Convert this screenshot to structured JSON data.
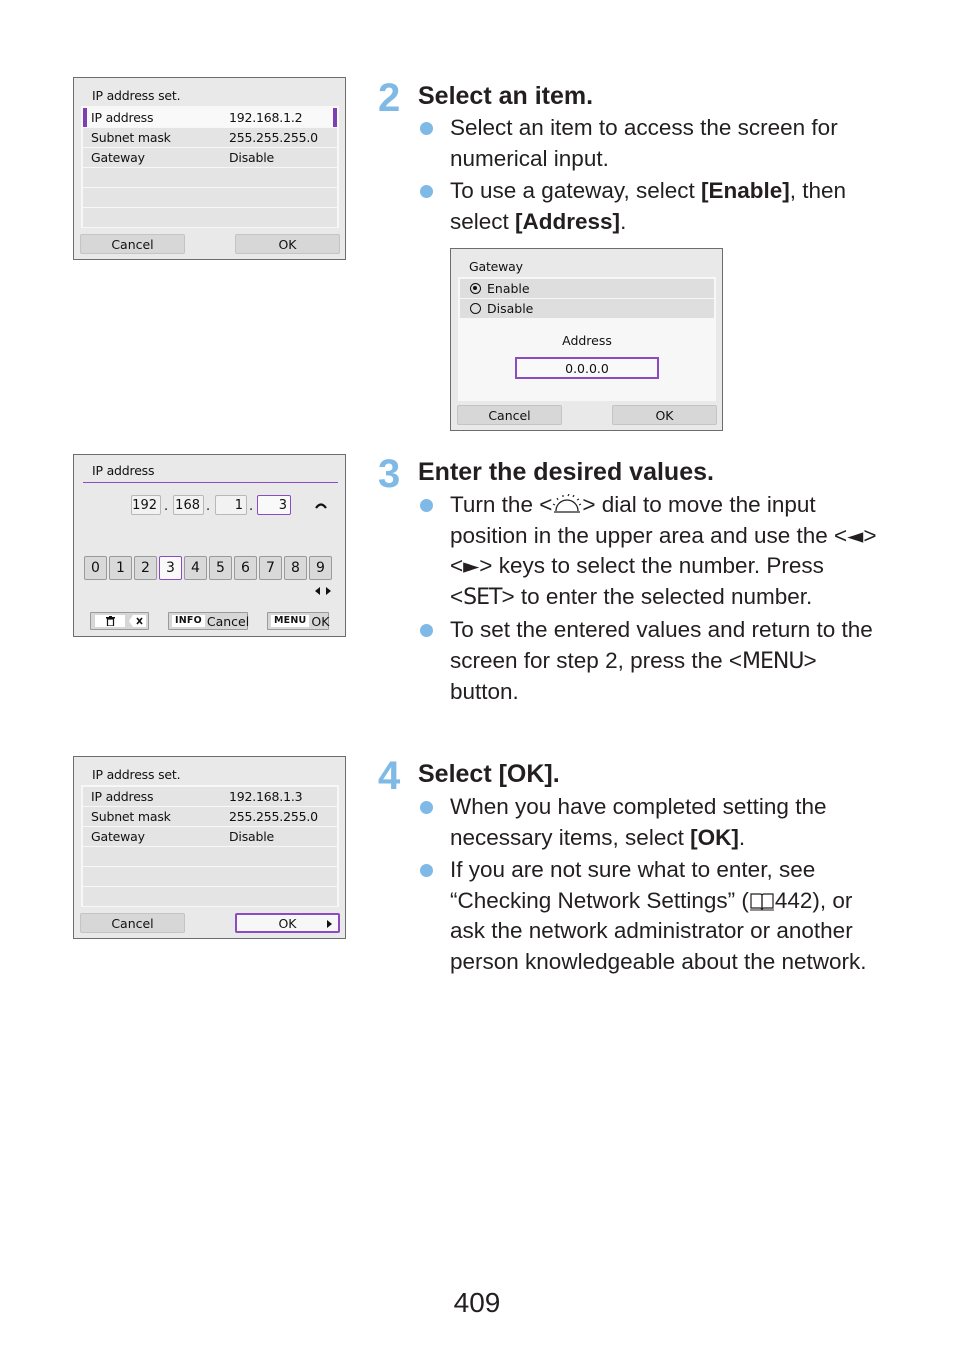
{
  "page_number": "409",
  "colors": {
    "step_number": "#7fb9e6",
    "bullet": "#7fb9e6",
    "focus_highlight": "#8a4cc0",
    "screen_bg": "#e9e9e9"
  },
  "screen1": {
    "title": "IP address set.",
    "rows": [
      {
        "label": "IP address",
        "value": "192.168.1.2",
        "selected": true
      },
      {
        "label": "Subnet mask",
        "value": "255.255.255.0"
      },
      {
        "label": "Gateway",
        "value": "Disable"
      }
    ],
    "cancel_label": "Cancel",
    "ok_label": "OK"
  },
  "screen2": {
    "title": "Gateway",
    "options": [
      {
        "label": "Enable",
        "selected": true
      },
      {
        "label": "Disable",
        "selected": false
      }
    ],
    "address_label": "Address",
    "address_value": "0.0.0.0",
    "cancel_label": "Cancel",
    "ok_label": "OK"
  },
  "screen3": {
    "title": "IP address",
    "octets": [
      "192",
      "168",
      "1",
      "3"
    ],
    "active_octet": 3,
    "digits": [
      "0",
      "1",
      "2",
      "3",
      "4",
      "5",
      "6",
      "7",
      "8",
      "9"
    ],
    "active_digit": "3",
    "delete_hint": {
      "trash_icon": "trash-icon",
      "backspace_icon": "backspace-icon"
    },
    "cancel_hint": {
      "key": "INFO",
      "label": "Cancel"
    },
    "ok_hint": {
      "key": "MENU",
      "label": "OK"
    }
  },
  "screen4": {
    "title": "IP address set.",
    "rows": [
      {
        "label": "IP address",
        "value": "192.168.1.3"
      },
      {
        "label": "Subnet mask",
        "value": "255.255.255.0"
      },
      {
        "label": "Gateway",
        "value": "Disable"
      }
    ],
    "cancel_label": "Cancel",
    "ok_label": "OK"
  },
  "steps": [
    {
      "number": "2",
      "title": "Select an item.",
      "bullets": [
        {
          "text": "Select an item to access the screen for numerical input."
        },
        {
          "pre": "To use a gateway, select ",
          "bold1": "[Enable]",
          "mid": ", then select ",
          "bold2": "[Address]",
          "post": "."
        }
      ]
    },
    {
      "number": "3",
      "title": "Enter the desired values.",
      "bullets": [
        {
          "part1": "Turn the <",
          "dial_icon": "main-dial-icon",
          "part2": "> dial to move the input position in the upper area and use the <",
          "left_key": "◄",
          "part3": "> <",
          "right_key": "►",
          "part4": "> keys to select the number. Press <",
          "set_key": "SET",
          "part5": "> to enter the selected number."
        },
        {
          "part1": "To set the entered values and return to the screen for step 2, press the <",
          "menu_key": "MENU",
          "part2": "> button."
        }
      ]
    },
    {
      "number": "4",
      "title": "Select [OK].",
      "bullets": [
        {
          "pre": "When you have completed setting the necessary items, select ",
          "bold": "[OK]",
          "post": "."
        },
        {
          "pre": "If you are not sure what to enter, see “Checking Network Settings” (",
          "book_icon": "page-reference-icon",
          "page_ref": "442",
          "post": "), or ask the network administrator or another person knowledgeable about the network."
        }
      ]
    }
  ]
}
